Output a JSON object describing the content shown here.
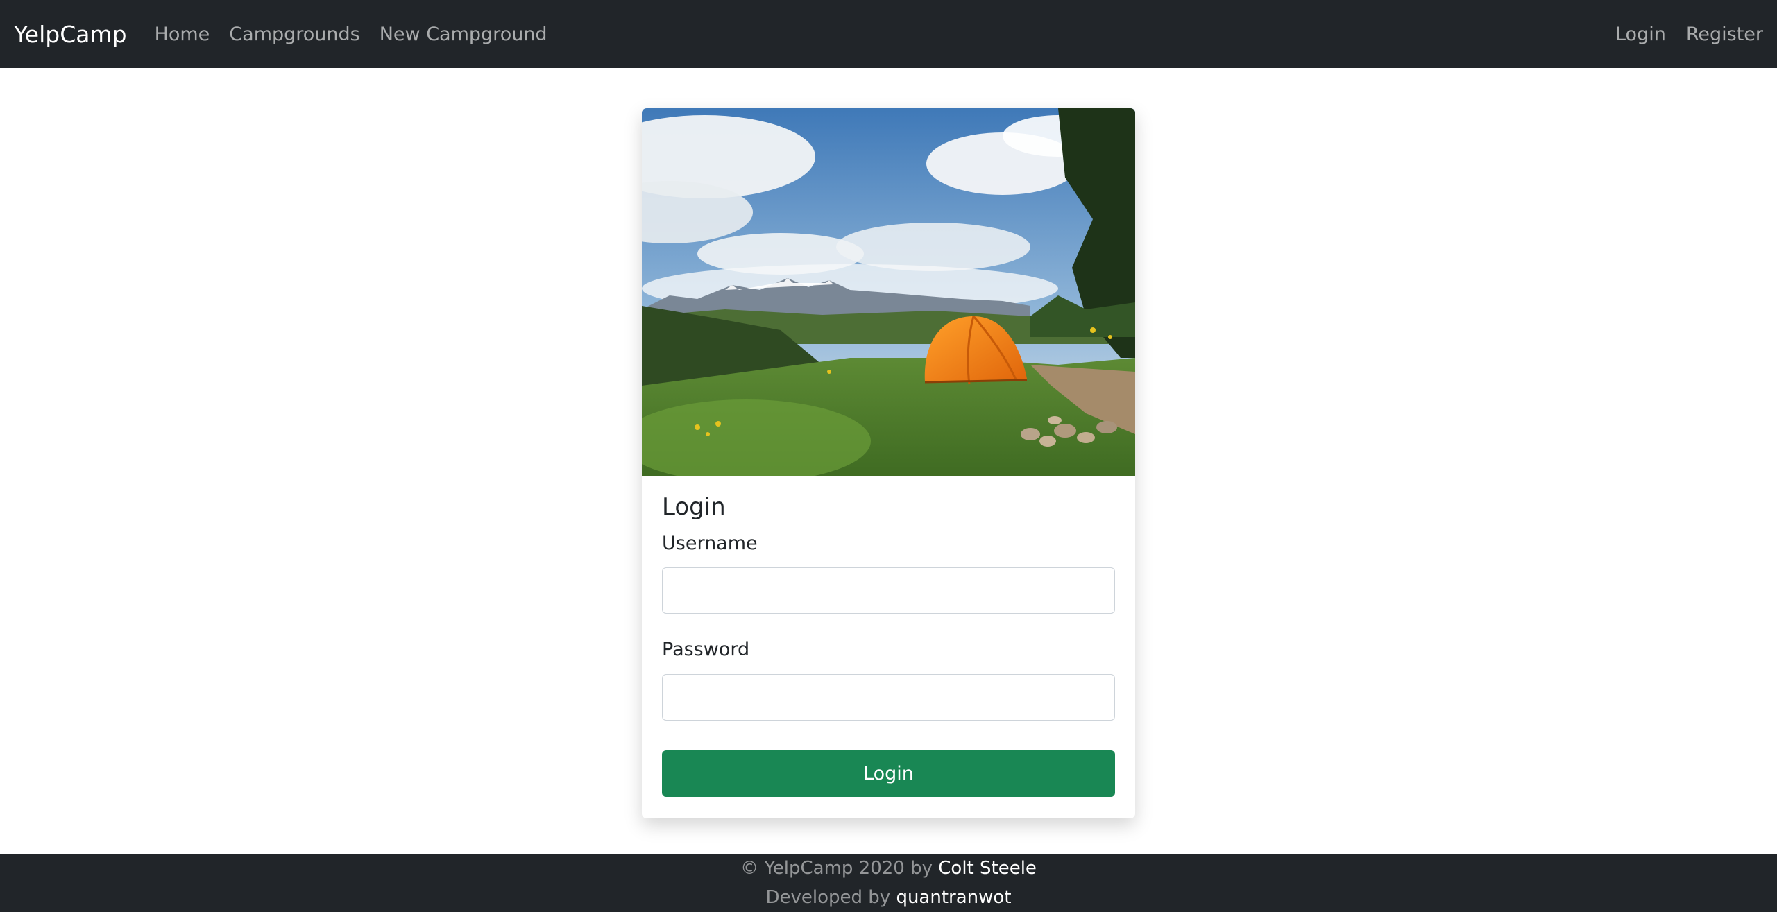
{
  "navbar": {
    "brand": "YelpCamp",
    "links": [
      {
        "label": "Home"
      },
      {
        "label": "Campgrounds"
      },
      {
        "label": "New Campground"
      }
    ],
    "right_links": [
      {
        "label": "Login"
      },
      {
        "label": "Register"
      }
    ]
  },
  "card": {
    "image": "camping-tent-mountain-landscape",
    "title": "Login",
    "username_label": "Username",
    "username_value": "",
    "password_label": "Password",
    "password_value": "",
    "submit_label": "Login"
  },
  "footer": {
    "line1_prefix": "© YelpCamp 2020 by",
    "line1_link": "Colt Steele",
    "line2_prefix": "Developed by",
    "line2_link": "quantranwot"
  },
  "colors": {
    "navbar_bg": "#212529",
    "button_green": "#198754",
    "tent_orange": "#f07d10"
  }
}
